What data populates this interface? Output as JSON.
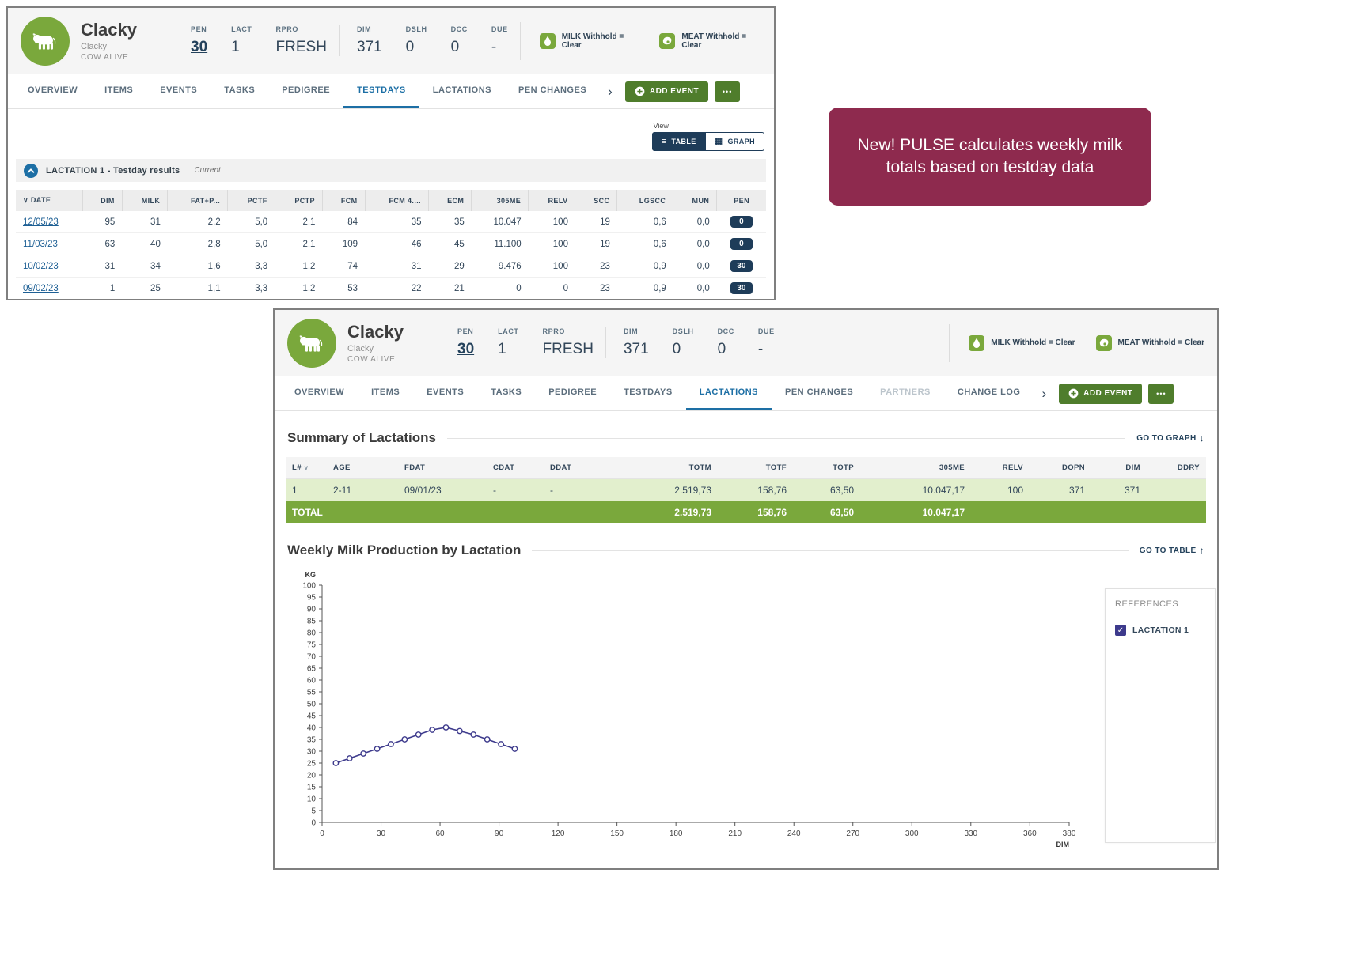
{
  "callout": {
    "text": "New! PULSE calculates weekly milk totals based on testday data"
  },
  "icons": {
    "chevron_right": "›",
    "sort_caret": "∨",
    "arrow_down": "↓",
    "arrow_up": "↑",
    "check": "✓",
    "table_icon": "≡",
    "graph_icon": "▦"
  },
  "shared": {
    "cow": {
      "name": "Clacky",
      "subname": "Clacky",
      "status": "COW ALIVE"
    },
    "stats": [
      {
        "label": "PEN",
        "value": "30",
        "link": true
      },
      {
        "label": "LACT",
        "value": "1"
      },
      {
        "label": "RPRO",
        "value": "FRESH"
      },
      {
        "label": "DIM",
        "value": "371"
      },
      {
        "label": "DSLH",
        "value": "0"
      },
      {
        "label": "DCC",
        "value": "0"
      },
      {
        "label": "DUE",
        "value": "-"
      }
    ],
    "withholds": [
      {
        "type": "milk",
        "icon": "milk-drop-icon",
        "label": "MILK Withhold = Clear"
      },
      {
        "type": "meat",
        "icon": "meat-icon",
        "label": "MEAT Withhold = Clear"
      }
    ],
    "add_event_label": "ADD EVENT",
    "more_label": "•••"
  },
  "window1": {
    "tabs": [
      {
        "label": "OVERVIEW"
      },
      {
        "label": "ITEMS"
      },
      {
        "label": "EVENTS"
      },
      {
        "label": "TASKS"
      },
      {
        "label": "PEDIGREE"
      },
      {
        "label": "TESTDAYS",
        "active": true
      },
      {
        "label": "LACTATIONS"
      },
      {
        "label": "PEN CHANGES"
      }
    ],
    "view": {
      "label": "View",
      "options": [
        {
          "label": "TABLE",
          "icon": "table_icon",
          "active": true
        },
        {
          "label": "GRAPH",
          "icon": "graph_icon"
        }
      ]
    },
    "section": {
      "title": "LACTATION 1 - Testday results",
      "tag": "Current"
    },
    "table": {
      "columns": [
        "DATE",
        "DIM",
        "MILK",
        "FAT+P...",
        "PCTF",
        "PCTP",
        "FCM",
        "FCM 4....",
        "ECM",
        "305ME",
        "RELV",
        "SCC",
        "LGSCC",
        "MUN",
        "PEN"
      ],
      "rows": [
        {
          "date": "12/05/23",
          "values": [
            "95",
            "31",
            "2,2",
            "5,0",
            "2,1",
            "84",
            "35",
            "35",
            "10.047",
            "100",
            "19",
            "0,6",
            "0,0"
          ],
          "pen": "0"
        },
        {
          "date": "11/03/23",
          "values": [
            "63",
            "40",
            "2,8",
            "5,0",
            "2,1",
            "109",
            "46",
            "45",
            "11.100",
            "100",
            "19",
            "0,6",
            "0,0"
          ],
          "pen": "0"
        },
        {
          "date": "10/02/23",
          "values": [
            "31",
            "34",
            "1,6",
            "3,3",
            "1,2",
            "74",
            "31",
            "29",
            "9.476",
            "100",
            "23",
            "0,9",
            "0,0"
          ],
          "pen": "30"
        },
        {
          "date": "09/02/23",
          "values": [
            "1",
            "25",
            "1,1",
            "3,3",
            "1,2",
            "53",
            "22",
            "21",
            "0",
            "0",
            "23",
            "0,9",
            "0,0"
          ],
          "pen": "30"
        }
      ]
    }
  },
  "window2": {
    "tabs": [
      {
        "label": "OVERVIEW"
      },
      {
        "label": "ITEMS"
      },
      {
        "label": "EVENTS"
      },
      {
        "label": "TASKS"
      },
      {
        "label": "PEDIGREE"
      },
      {
        "label": "TESTDAYS"
      },
      {
        "label": "LACTATIONS",
        "active": true
      },
      {
        "label": "PEN CHANGES"
      },
      {
        "label": "PARTNERS",
        "disabled": true
      },
      {
        "label": "CHANGE LOG"
      }
    ],
    "summary": {
      "title": "Summary of Lactations",
      "link": "GO TO GRAPH",
      "columns": [
        "L#",
        "AGE",
        "FDAT",
        "CDAT",
        "DDAT",
        "TOTM",
        "TOTF",
        "TOTP",
        "305ME",
        "RELV",
        "DOPN",
        "DIM",
        "DDRY"
      ],
      "rows": [
        [
          "1",
          "2-11",
          "09/01/23",
          "-",
          "-",
          "2.519,73",
          "158,76",
          "63,50",
          "10.047,17",
          "100",
          "371",
          "371",
          ""
        ]
      ],
      "total_row": [
        "TOTAL",
        "",
        "",
        "",
        "",
        "2.519,73",
        "158,76",
        "63,50",
        "10.047,17",
        "",
        "",
        "",
        ""
      ]
    },
    "weekly": {
      "title": "Weekly Milk Production by Lactation",
      "link": "GO TO TABLE"
    },
    "references": {
      "title": "REFERENCES",
      "items": [
        {
          "label": "LACTATION 1",
          "checked": true
        }
      ]
    }
  },
  "chart_data": {
    "type": "line",
    "title": "Weekly Milk Production by Lactation",
    "xlabel": "DIM",
    "ylabel": "KG",
    "xlim": [
      0,
      380
    ],
    "ylim": [
      0,
      100
    ],
    "x_ticks": [
      0,
      30,
      60,
      90,
      120,
      150,
      180,
      210,
      240,
      270,
      300,
      330,
      360,
      380
    ],
    "y_tick_step": 5,
    "grid": false,
    "legend": {
      "position": "right-panel",
      "entries": [
        "LACTATION 1"
      ]
    },
    "series": [
      {
        "name": "LACTATION 1",
        "color": "#3d3a8c",
        "x": [
          7,
          14,
          21,
          28,
          35,
          42,
          49,
          56,
          63,
          70,
          77,
          84,
          91,
          98
        ],
        "y": [
          25,
          27,
          29,
          31,
          33,
          35,
          37,
          39,
          40,
          38.5,
          37,
          35,
          33,
          31
        ]
      }
    ]
  }
}
